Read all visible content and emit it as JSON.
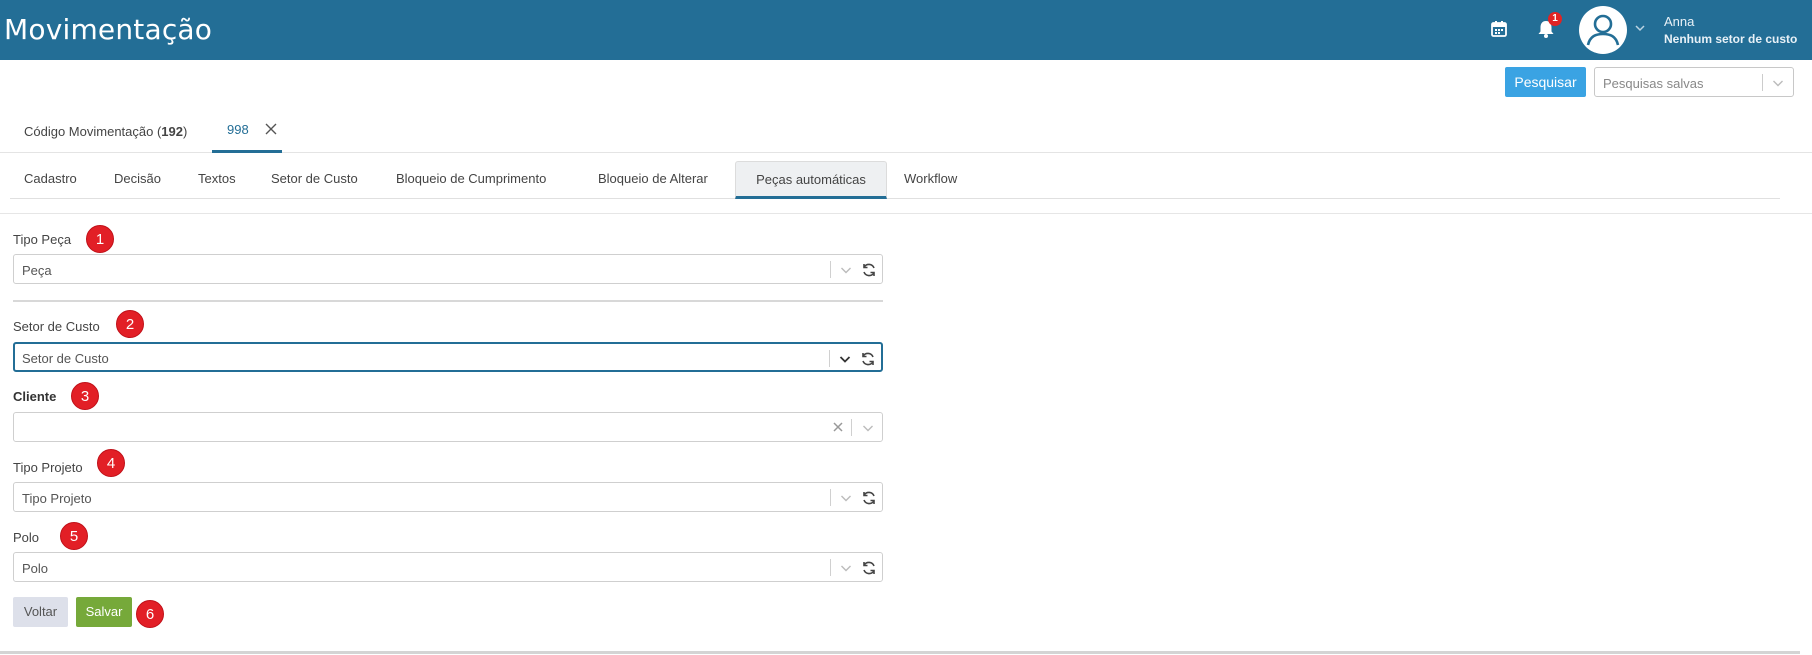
{
  "header": {
    "title": "Movimentação",
    "notification_count": "1",
    "user_name": "Anna",
    "user_sector": "Nenhum setor de custo"
  },
  "search": {
    "button_label": "Pesquisar",
    "saved_placeholder": "Pesquisas salvas"
  },
  "record_tabs": {
    "list_label_prefix": "Código Movimentação (",
    "list_count": "192",
    "list_label_suffix": ")",
    "open_record": "998"
  },
  "section_tabs": [
    {
      "label": "Cadastro"
    },
    {
      "label": "Decisão"
    },
    {
      "label": "Textos"
    },
    {
      "label": "Setor de Custo"
    },
    {
      "label": "Bloqueio de Cumprimento"
    },
    {
      "label": "Bloqueio de Alterar"
    },
    {
      "label": "Peças automáticas"
    },
    {
      "label": "Workflow"
    }
  ],
  "active_tab": "Peças automáticas",
  "form": {
    "fields": [
      {
        "label": "Tipo Peça",
        "value": "Peça",
        "marker": "1"
      },
      {
        "label": "Setor de Custo",
        "value": "Setor de Custo",
        "marker": "2"
      },
      {
        "label": "Cliente",
        "value": "",
        "marker": "3"
      },
      {
        "label": "Tipo Projeto",
        "value": "Tipo Projeto",
        "marker": "4"
      },
      {
        "label": "Polo",
        "value": "Polo",
        "marker": "5"
      }
    ],
    "back_label": "Voltar",
    "save_label": "Salvar",
    "save_marker": "6"
  },
  "colors": {
    "header_bg": "#236e96",
    "primary_button": "#3aa3e3",
    "save_button": "#76a93a",
    "marker": "#e21f26"
  }
}
